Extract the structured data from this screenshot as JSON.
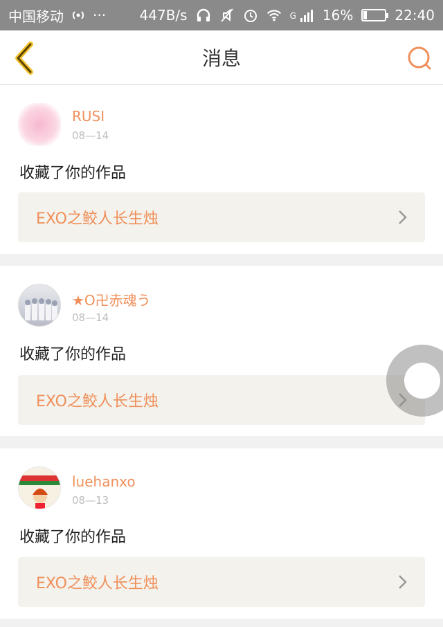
{
  "status_bar": {
    "carrier": "中国移动",
    "dots": "···",
    "speed": "447B/s",
    "network": "G",
    "battery": "16%",
    "battery_level": 0.16,
    "time": "22:40"
  },
  "header": {
    "title": "消息",
    "back_icon": "chevron-left-icon",
    "search_icon": "search-icon",
    "accent_color": "#f08f5a"
  },
  "messages": [
    {
      "username": "RUSI",
      "date": "08—14",
      "action": "收藏了你的作品",
      "work_title": "EXO之鲛人长生烛"
    },
    {
      "username": "★O卍赤魂う",
      "date": "08—14",
      "action": "收藏了你的作品",
      "work_title": "EXO之鲛人长生烛"
    },
    {
      "username": "luehanxo",
      "date": "08—13",
      "action": "收藏了你的作品",
      "work_title": "EXO之鲛人长生烛"
    }
  ]
}
